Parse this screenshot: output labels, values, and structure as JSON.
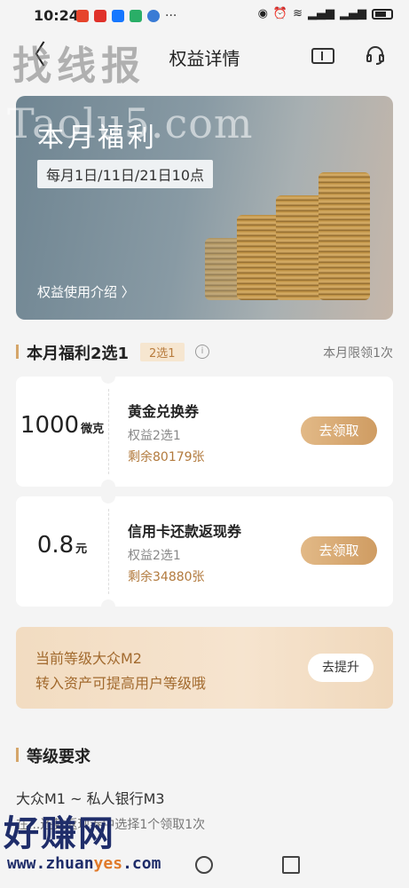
{
  "status": {
    "time": "10:24",
    "dots": "···"
  },
  "nav": {
    "back": "〈",
    "title": "权益详情"
  },
  "watermarks": {
    "top": "找线报",
    "mid": "Taolu5.com",
    "bottom": "好赚网",
    "url_a": "www.zhuan",
    "url_b": "yes",
    "url_c": ".com"
  },
  "banner": {
    "title": "本月福利",
    "schedule": "每月1日/11日/21日10点",
    "link": "权益使用介绍  〉"
  },
  "section": {
    "title": "本月福利2选1",
    "tag": "2选1",
    "info": "i",
    "limit": "本月限领1次"
  },
  "coupons": [
    {
      "amount": "1000",
      "unit": "微克",
      "name": "黄金兑换券",
      "sub": "权益2选1",
      "remain": "剩余80179张",
      "button": "去领取"
    },
    {
      "amount": "0.8",
      "unit": "元",
      "name": "信用卡还款返现券",
      "sub": "权益2选1",
      "remain": "剩余34880张",
      "button": "去领取"
    }
  ],
  "level": {
    "line1": "当前等级大众M2",
    "line2": "转入资产可提高用户等级哦",
    "button": "去提升"
  },
  "requirement": {
    "title": "等级要求",
    "line1": "大众M1 ~ 私人银行M3",
    "line2": "在...还款返现券中选择1个领取1次"
  }
}
